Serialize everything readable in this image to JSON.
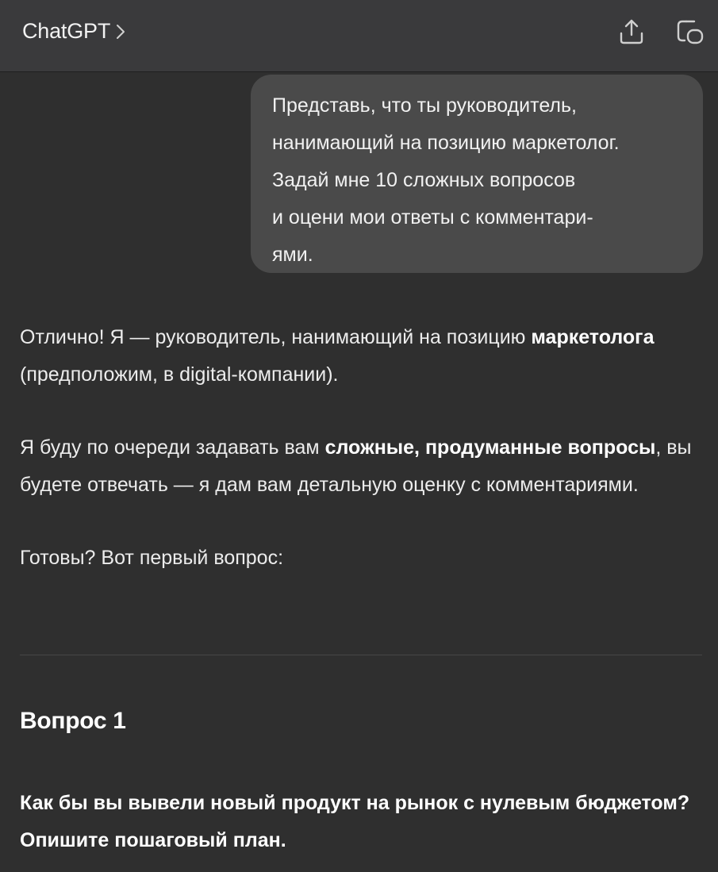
{
  "header": {
    "title": "ChatGPT",
    "chevron_icon": "chevron-right-icon",
    "share_icon": "share-upload-icon",
    "new_chat_icon": "new-chat-icon"
  },
  "user_message": {
    "text": "Представь, что ты руководитель, нанимающий на позицию маркетолог. Задай мне 10 сложных вопросов и оцени мои ответы с комментари-ями.",
    "lines": [
      "Представь, что ты руководитель,",
      "нанимающий на позицию маркетолог.",
      "Задай мне 10 сложных вопросов",
      "и оцени мои ответы с комментари-",
      "ями."
    ]
  },
  "assistant_message": {
    "p1_start": "Отлично! Я — руководитель, нанимающий на позицию ",
    "p1_bold": "маркетолога",
    "p1_end": " (предположим, в digital-компании).",
    "p2_start": "Я буду по очереди задавать вам ",
    "p2_bold": "сложные, продуманные вопросы",
    "p2_end": ", вы будете отвечать — я дам вам детальную оценку с комментариями.",
    "p3": "Готовы? Вот первый вопрос:",
    "question_heading": "Вопрос 1",
    "question_text": "Как бы вы вывели новый продукт на рынок с нулевым бюджетом? Опишите пошаговый план."
  },
  "colors": {
    "background": "#2f2f2f",
    "header": "#3a3a3c",
    "user_bubble": "#4a4a4a",
    "text": "#ececec"
  }
}
